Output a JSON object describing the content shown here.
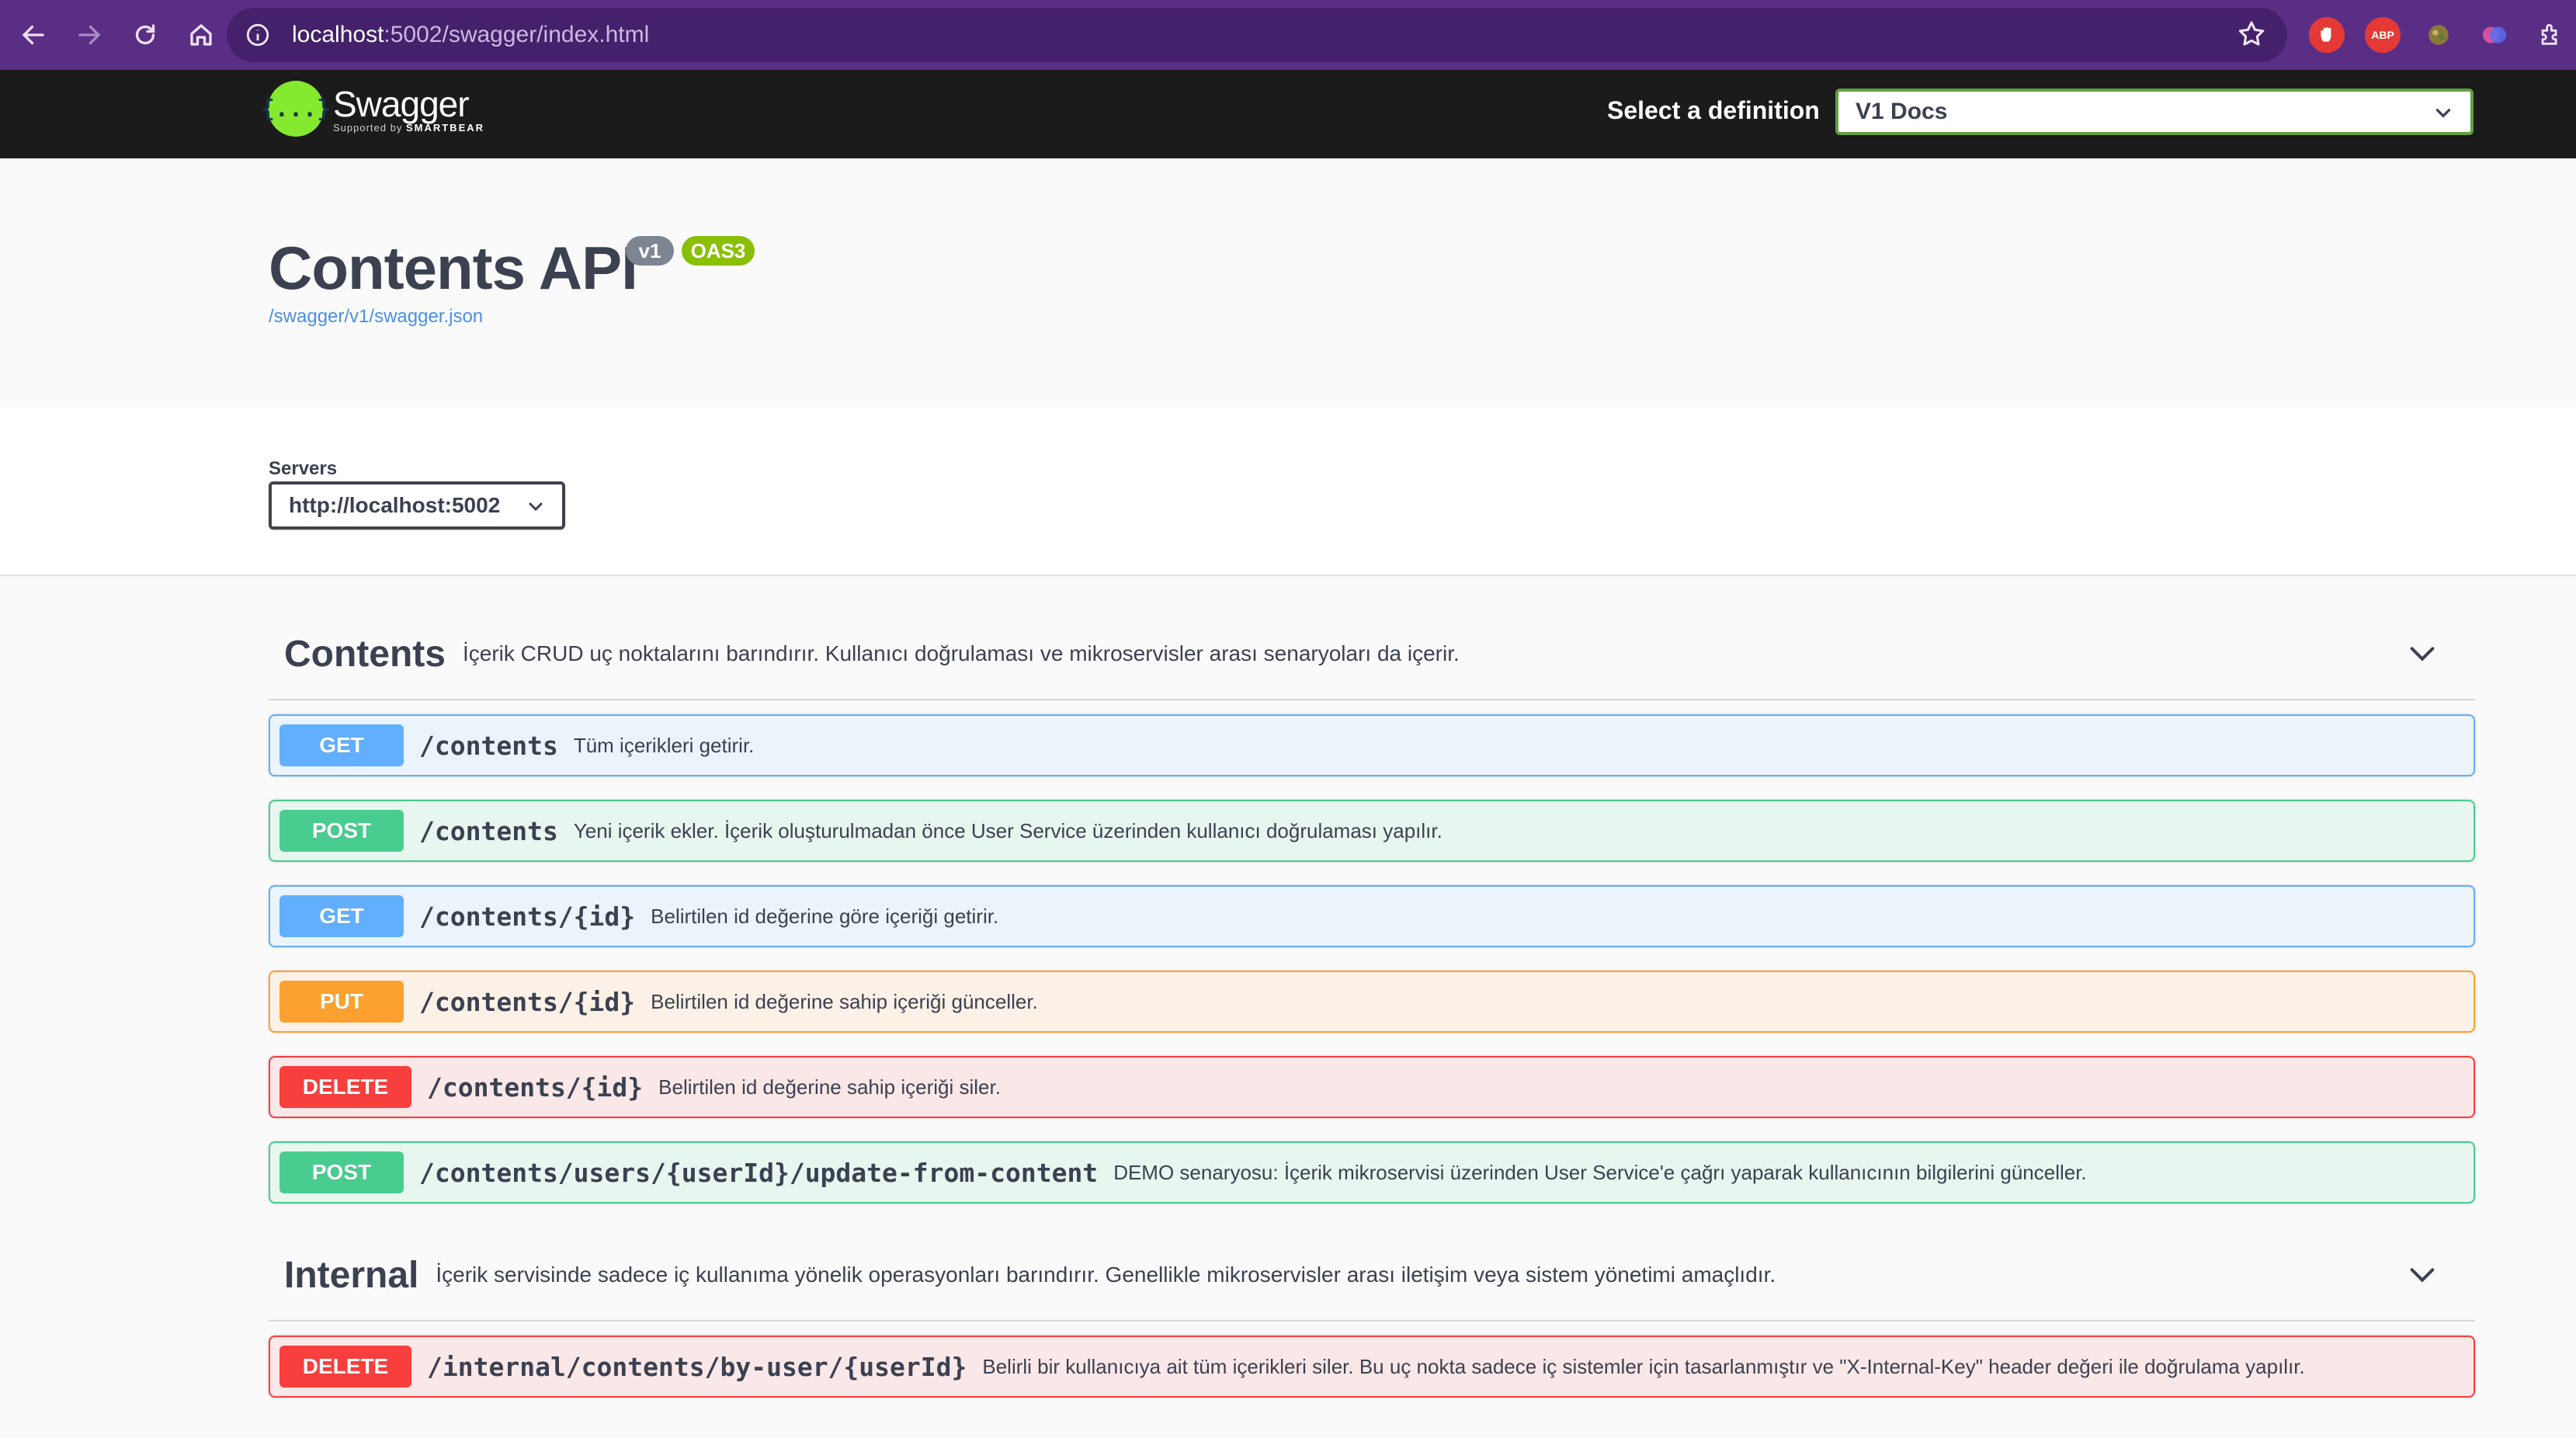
{
  "browser": {
    "url_host": "localhost",
    "url_rest": ":5002/swagger/index.html",
    "extensions": [
      {
        "name": "adblock-extension-icon",
        "label": "",
        "color": "#e53935"
      },
      {
        "name": "abp-extension-icon",
        "label": "ABP",
        "color": "#e53935"
      },
      {
        "name": "puzzle-extension-icon",
        "label": "",
        "color": "#7a7a3a"
      },
      {
        "name": "colorful-extension-icon",
        "label": "",
        "color": "#8e44ad"
      }
    ]
  },
  "topbar": {
    "logo_name": "Swagger",
    "logo_supported": "Supported by",
    "logo_smartbear": "SMARTBEAR",
    "logo_glyph": "{...}",
    "definition_label": "Select a definition",
    "definition_value": "V1 Docs"
  },
  "info": {
    "title": "Contents API",
    "version_badge": "v1",
    "oas_badge": "OAS3",
    "spec_link": "/swagger/v1/swagger.json"
  },
  "servers": {
    "label": "Servers",
    "selected": "http://localhost:5002"
  },
  "tags": [
    {
      "name": "Contents",
      "description": "İçerik CRUD uç noktalarını barındırır. Kullanıcı doğrulaması ve mikroservisler arası senaryoları da içerir.",
      "operations": [
        {
          "method": "GET",
          "path": "/contents",
          "summary": "Tüm içerikleri getirir."
        },
        {
          "method": "POST",
          "path": "/contents",
          "summary": "Yeni içerik ekler. İçerik oluşturulmadan önce User Service üzerinden kullanıcı doğrulaması yapılır."
        },
        {
          "method": "GET",
          "path": "/contents/{id}",
          "summary": "Belirtilen id değerine göre içeriği getirir."
        },
        {
          "method": "PUT",
          "path": "/contents/{id}",
          "summary": "Belirtilen id değerine sahip içeriği günceller."
        },
        {
          "method": "DELETE",
          "path": "/contents/{id}",
          "summary": "Belirtilen id değerine sahip içeriği siler."
        },
        {
          "method": "POST",
          "path": "/contents/users/{userId}/update-from-content",
          "summary": "DEMO senaryosu: İçerik mikroservisi üzerinden User Service'e çağrı yaparak kullanıcının bilgilerini günceller."
        }
      ]
    },
    {
      "name": "Internal",
      "description": "İçerik servisinde sadece iç kullanıma yönelik operasyonları barındırır. Genellikle mikroservisler arası iletişim veya sistem yönetimi amaçlıdır.",
      "operations": [
        {
          "method": "DELETE",
          "path": "/internal/contents/by-user/{userId}",
          "summary": "Belirli bir kullanıcıya ait tüm içerikleri siler. Bu uç nokta sadece iç sistemler için tasarlanmıştır ve \"X-Internal-Key\" header değeri ile doğrulama yapılır."
        }
      ]
    }
  ],
  "colors": {
    "get": "#61affe",
    "post": "#49cc90",
    "put": "#fca130",
    "delete": "#f93e3e",
    "browser_frame": "#5b2e86"
  }
}
